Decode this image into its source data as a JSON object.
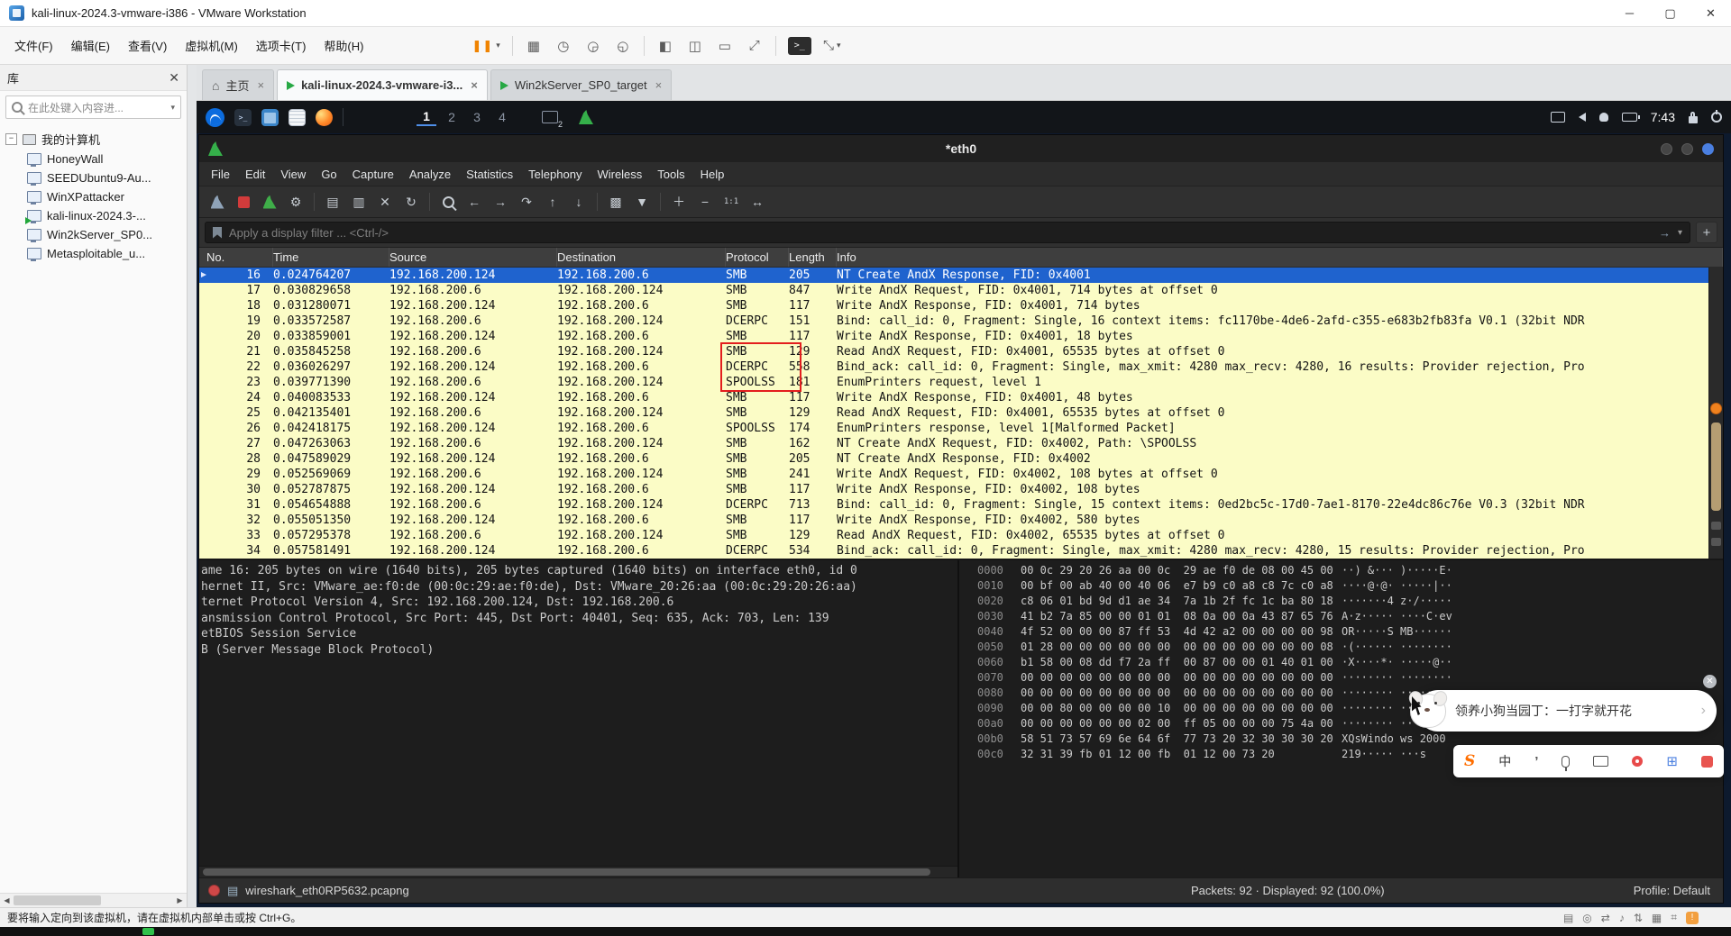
{
  "window": {
    "title": "kali-linux-2024.3-vmware-i386 - VMware Workstation"
  },
  "vmware": {
    "menus": [
      "文件(F)",
      "编辑(E)",
      "查看(V)",
      "虚拟机(M)",
      "选项卡(T)",
      "帮助(H)"
    ],
    "sidebar": {
      "title": "库",
      "search_placeholder": "在此处键入内容进...",
      "root_label": "我的计算机",
      "items": [
        {
          "label": "HoneyWall",
          "running": false
        },
        {
          "label": "SEEDUbuntu9-Au...",
          "running": false
        },
        {
          "label": "WinXPattacker",
          "running": false
        },
        {
          "label": "kali-linux-2024.3-...",
          "running": true
        },
        {
          "label": "Win2kServer_SP0...",
          "running": false
        },
        {
          "label": "Metasploitable_u...",
          "running": false
        }
      ]
    },
    "tabs": [
      {
        "label": "主页",
        "icon": "home",
        "active": false
      },
      {
        "label": "kali-linux-2024.3-vmware-i3...",
        "icon": "vm",
        "active": true
      },
      {
        "label": "Win2kServer_SP0_target",
        "icon": "vm",
        "active": false
      }
    ],
    "status_hint": "要将输入定向到该虚拟机，请在虚拟机内部单击或按 Ctrl+G。"
  },
  "kali": {
    "workspaces": [
      "1",
      "2",
      "3",
      "4"
    ],
    "active_workspace": "1",
    "window_count_badge": "2",
    "clock": "7:43"
  },
  "wireshark": {
    "title": "*eth0",
    "menus": [
      "File",
      "Edit",
      "View",
      "Go",
      "Capture",
      "Analyze",
      "Statistics",
      "Telephony",
      "Wireless",
      "Tools",
      "Help"
    ],
    "filter_placeholder": "Apply a display filter ... <Ctrl-/>",
    "columns": [
      "No.",
      "Time",
      "Source",
      "Destination",
      "Protocol",
      "Length",
      "Info"
    ],
    "packets": [
      {
        "no": "16",
        "time": "0.024764207",
        "source": "192.168.200.124",
        "destination": "192.168.200.6",
        "protocol": "SMB",
        "length": "205",
        "info": "NT Create AndX Response, FID: 0x4001",
        "selected": true
      },
      {
        "no": "17",
        "time": "0.030829658",
        "source": "192.168.200.6",
        "destination": "192.168.200.124",
        "protocol": "SMB",
        "length": "847",
        "info": "Write AndX Request, FID: 0x4001, 714 bytes at offset 0",
        "selected": false
      },
      {
        "no": "18",
        "time": "0.031280071",
        "source": "192.168.200.124",
        "destination": "192.168.200.6",
        "protocol": "SMB",
        "length": "117",
        "info": "Write AndX Response, FID: 0x4001, 714 bytes",
        "selected": false
      },
      {
        "no": "19",
        "time": "0.033572587",
        "source": "192.168.200.6",
        "destination": "192.168.200.124",
        "protocol": "DCERPC",
        "length": "151",
        "info": "Bind: call_id: 0, Fragment: Single, 16 context items: fc1170be-4de6-2afd-c355-e683b2fb83fa V0.1 (32bit NDR",
        "selected": false
      },
      {
        "no": "20",
        "time": "0.033859001",
        "source": "192.168.200.124",
        "destination": "192.168.200.6",
        "protocol": "SMB",
        "length": "117",
        "info": "Write AndX Response, FID: 0x4001, 18 bytes",
        "selected": false
      },
      {
        "no": "21",
        "time": "0.035845258",
        "source": "192.168.200.6",
        "destination": "192.168.200.124",
        "protocol": "SMB",
        "length": "129",
        "info": "Read AndX Request, FID: 0x4001, 65535 bytes at offset 0",
        "selected": false
      },
      {
        "no": "22",
        "time": "0.036026297",
        "source": "192.168.200.124",
        "destination": "192.168.200.6",
        "protocol": "DCERPC",
        "length": "558",
        "info": "Bind_ack: call_id: 0, Fragment: Single, max_xmit: 4280 max_recv: 4280, 16 results: Provider rejection, Pro",
        "selected": false
      },
      {
        "no": "23",
        "time": "0.039771390",
        "source": "192.168.200.6",
        "destination": "192.168.200.124",
        "protocol": "SPOOLSS",
        "length": "181",
        "info": "EnumPrinters request, level 1",
        "selected": false
      },
      {
        "no": "24",
        "time": "0.040083533",
        "source": "192.168.200.124",
        "destination": "192.168.200.6",
        "protocol": "SMB",
        "length": "117",
        "info": "Write AndX Response, FID: 0x4001, 48 bytes",
        "selected": false
      },
      {
        "no": "25",
        "time": "0.042135401",
        "source": "192.168.200.6",
        "destination": "192.168.200.124",
        "protocol": "SMB",
        "length": "129",
        "info": "Read AndX Request, FID: 0x4001, 65535 bytes at offset 0",
        "selected": false
      },
      {
        "no": "26",
        "time": "0.042418175",
        "source": "192.168.200.124",
        "destination": "192.168.200.6",
        "protocol": "SPOOLSS",
        "length": "174",
        "info": "EnumPrinters response, level 1[Malformed Packet]",
        "selected": false
      },
      {
        "no": "27",
        "time": "0.047263063",
        "source": "192.168.200.6",
        "destination": "192.168.200.124",
        "protocol": "SMB",
        "length": "162",
        "info": "NT Create AndX Request, FID: 0x4002, Path: \\SPOOLSS",
        "selected": false
      },
      {
        "no": "28",
        "time": "0.047589029",
        "source": "192.168.200.124",
        "destination": "192.168.200.6",
        "protocol": "SMB",
        "length": "205",
        "info": "NT Create AndX Response, FID: 0x4002",
        "selected": false
      },
      {
        "no": "29",
        "time": "0.052569069",
        "source": "192.168.200.6",
        "destination": "192.168.200.124",
        "protocol": "SMB",
        "length": "241",
        "info": "Write AndX Request, FID: 0x4002, 108 bytes at offset 0",
        "selected": false
      },
      {
        "no": "30",
        "time": "0.052787875",
        "source": "192.168.200.124",
        "destination": "192.168.200.6",
        "protocol": "SMB",
        "length": "117",
        "info": "Write AndX Response, FID: 0x4002, 108 bytes",
        "selected": false
      },
      {
        "no": "31",
        "time": "0.054654888",
        "source": "192.168.200.6",
        "destination": "192.168.200.124",
        "protocol": "DCERPC",
        "length": "713",
        "info": "Bind: call_id: 0, Fragment: Single, 15 context items: 0ed2bc5c-17d0-7ae1-8170-22e4dc86c76e V0.3 (32bit NDR",
        "selected": false
      },
      {
        "no": "32",
        "time": "0.055051350",
        "source": "192.168.200.124",
        "destination": "192.168.200.6",
        "protocol": "SMB",
        "length": "117",
        "info": "Write AndX Response, FID: 0x4002, 580 bytes",
        "selected": false
      },
      {
        "no": "33",
        "time": "0.057295378",
        "source": "192.168.200.6",
        "destination": "192.168.200.124",
        "protocol": "SMB",
        "length": "129",
        "info": "Read AndX Request, FID: 0x4002, 65535 bytes at offset 0",
        "selected": false
      },
      {
        "no": "34",
        "time": "0.057581491",
        "source": "192.168.200.124",
        "destination": "192.168.200.6",
        "protocol": "DCERPC",
        "length": "534",
        "info": "Bind_ack: call_id: 0, Fragment: Single, max_xmit: 4280 max_recv: 4280, 15 results: Provider rejection, Pro",
        "selected": false
      }
    ],
    "detail_lines": [
      "ame 16: 205 bytes on wire (1640 bits), 205 bytes captured (1640 bits) on interface eth0, id 0",
      "hernet II, Src: VMware_ae:f0:de (00:0c:29:ae:f0:de), Dst: VMware_20:26:aa (00:0c:29:20:26:aa)",
      "ternet Protocol Version 4, Src: 192.168.200.124, Dst: 192.168.200.6",
      "ansmission Control Protocol, Src Port: 445, Dst Port: 40401, Seq: 635, Ack: 703, Len: 139",
      "etBIOS Session Service",
      "B (Server Message Block Protocol)"
    ],
    "hex_rows": [
      {
        "offset": "0000",
        "hex": "00 0c 29 20 26 aa 00 0c  29 ae f0 de 08 00 45 00",
        "ascii": "··) &··· )·····E·"
      },
      {
        "offset": "0010",
        "hex": "00 bf 00 ab 40 00 40 06  e7 b9 c0 a8 c8 7c c0 a8",
        "ascii": "····@·@· ·····|··"
      },
      {
        "offset": "0020",
        "hex": "c8 06 01 bd 9d d1 ae 34  7a 1b 2f fc 1c ba 80 18",
        "ascii": "·······4 z·/·····"
      },
      {
        "offset": "0030",
        "hex": "41 b2 7a 85 00 00 01 01  08 0a 00 0a 43 87 65 76",
        "ascii": "A·z····· ····C·ev"
      },
      {
        "offset": "0040",
        "hex": "4f 52 00 00 00 87 ff 53  4d 42 a2 00 00 00 00 98",
        "ascii": "OR·····S MB······"
      },
      {
        "offset": "0050",
        "hex": "01 28 00 00 00 00 00 00  00 00 00 00 00 00 00 08",
        "ascii": "·(······ ········"
      },
      {
        "offset": "0060",
        "hex": "b1 58 00 08 dd f7 2a ff  00 87 00 00 01 40 01 00",
        "ascii": "·X····*· ·····@··"
      },
      {
        "offset": "0070",
        "hex": "00 00 00 00 00 00 00 00  00 00 00 00 00 00 00 00",
        "ascii": "········ ········"
      },
      {
        "offset": "0080",
        "hex": "00 00 00 00 00 00 00 00  00 00 00 00 00 00 00 00",
        "ascii": "········ ········"
      },
      {
        "offset": "0090",
        "hex": "00 00 80 00 00 00 00 10  00 00 00 00 00 00 00 00",
        "ascii": "········ ········"
      },
      {
        "offset": "00a0",
        "hex": "00 00 00 00 00 00 02 00  ff 05 00 00 00 75 4a 00",
        "ascii": "········ ·····uJ·"
      },
      {
        "offset": "00b0",
        "hex": "58 51 73 57 69 6e 64 6f  77 73 20 32 30 30 30 20",
        "ascii": "XQsWindo ws 2000 "
      },
      {
        "offset": "00c0",
        "hex": "32 31 39 fb 01 12 00 fb  01 12 00 73 20",
        "ascii": "219····· ···s "
      }
    ],
    "statusbar": {
      "filename": "wireshark_eth0RP5632.pcapng",
      "packets": "Packets: 92 · Displayed: 92 (100.0%)",
      "profile": "Profile: Default"
    }
  },
  "ime_popup": {
    "text": "领养小狗当园丁：一打字就开花"
  },
  "sogou": {
    "logo": "S",
    "mode": "中"
  }
}
